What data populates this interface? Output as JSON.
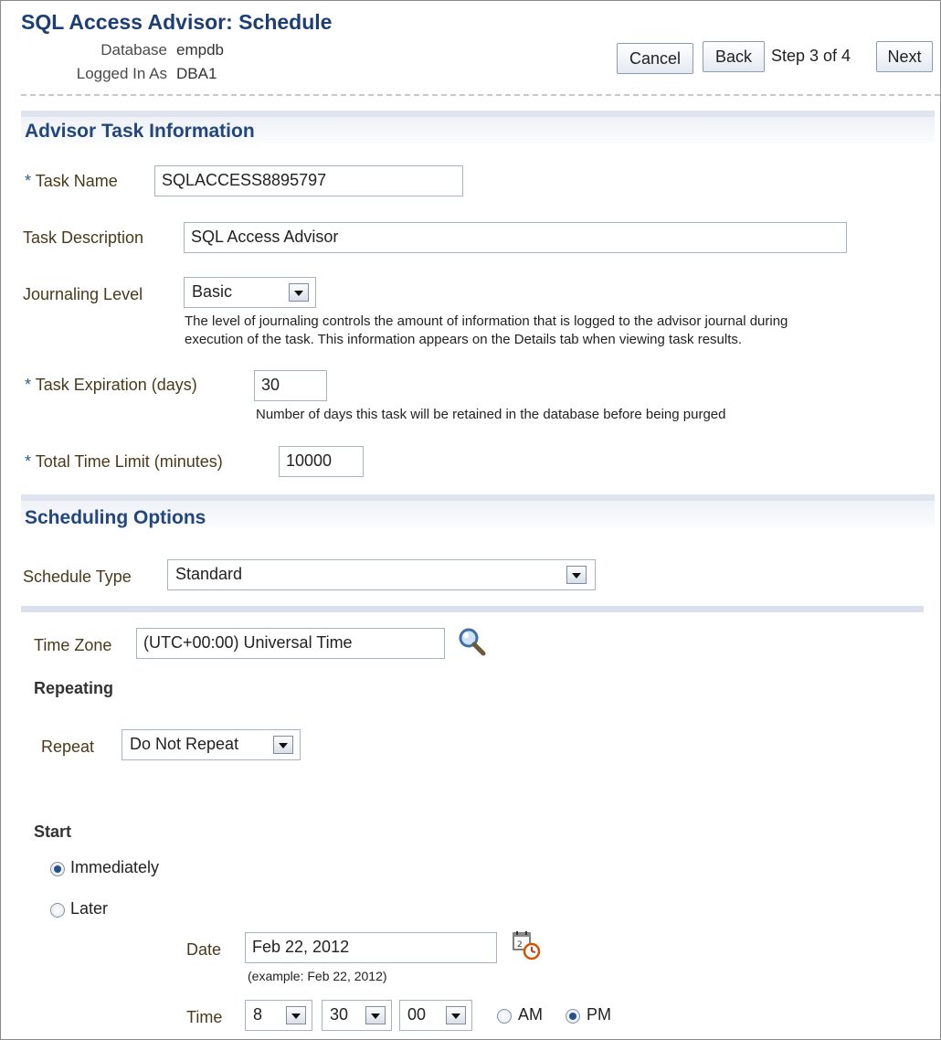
{
  "header": {
    "title": "SQL Access Advisor: Schedule",
    "database_label": "Database",
    "database_value": "empdb",
    "logged_label": "Logged In As",
    "logged_value": "DBA1",
    "cancel_label": "Cancel",
    "back_label": "Back",
    "step_text": "Step 3 of 4",
    "next_label": "Next"
  },
  "task_info": {
    "section_title": "Advisor Task Information",
    "task_name_label": "Task Name",
    "task_name_value": "SQLACCESS8895797",
    "task_desc_label": "Task Description",
    "task_desc_value": "SQL Access Advisor",
    "journaling_label": "Journaling Level",
    "journaling_value": "Basic",
    "journaling_hint_1": "The level of journaling controls the amount of information that is logged to the advisor journal during",
    "journaling_hint_2": "execution of the task. This information appears on the Details tab when viewing task results.",
    "expiration_label": "Task Expiration (days)",
    "expiration_value": "30",
    "expiration_hint": "Number of days this task will be retained in the database before being purged",
    "time_limit_label": "Total Time Limit (minutes)",
    "time_limit_value": "10000",
    "required_mark": "*"
  },
  "scheduling": {
    "section_title": "Scheduling Options",
    "schedule_type_label": "Schedule Type",
    "schedule_type_value": "Standard",
    "time_zone_label": "Time Zone",
    "time_zone_value": "(UTC+00:00) Universal Time",
    "repeating_title": "Repeating",
    "repeat_label": "Repeat",
    "repeat_value": "Do Not Repeat",
    "start_title": "Start",
    "immediately_label": "Immediately",
    "later_label": "Later",
    "start_selected": "Immediately",
    "date_label": "Date",
    "date_value": "Feb 22, 2012",
    "date_example": "(example: Feb 22, 2012)",
    "time_label": "Time",
    "hour_value": "8",
    "minute_value": "30",
    "second_value": "00",
    "am_label": "AM",
    "pm_label": "PM",
    "ampm_selected": "PM"
  },
  "icons": {
    "search": "magnifier-icon",
    "calendar": "calendar-clock-icon",
    "dropdown": "chevron-down-icon"
  },
  "colors": {
    "title": "#1d3e74",
    "section_title": "#22477e",
    "label": "#4a3a1a",
    "section_bar": "#dfe4ee"
  }
}
